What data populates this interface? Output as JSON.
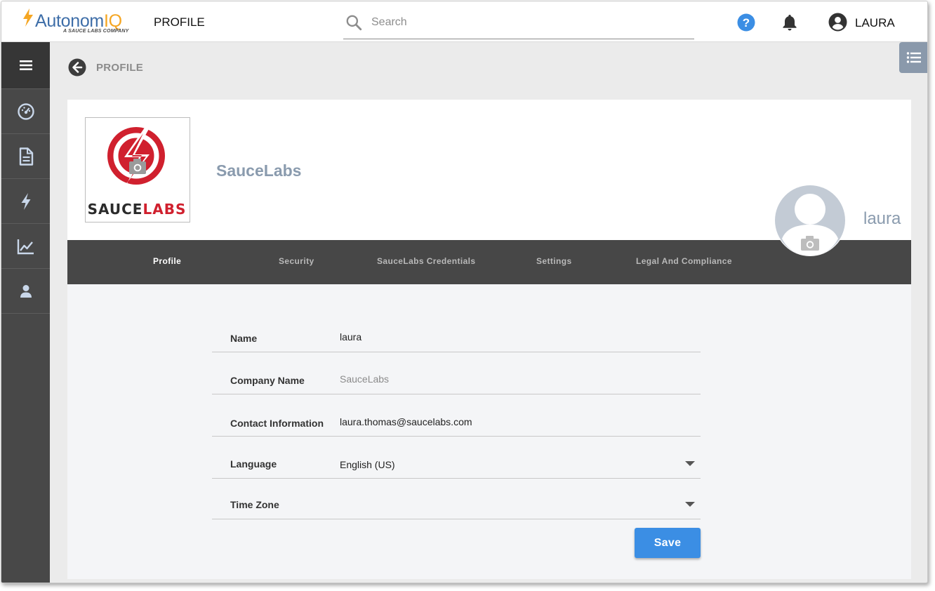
{
  "header": {
    "logo_text_main": "Autonom",
    "logo_text_accent": "IQ",
    "logo_subtitle": "A SAUCE LABS COMPANY",
    "page_title": "PROFILE",
    "search_placeholder": "Search",
    "user_name": "LAURA"
  },
  "sidebar": {
    "items": [
      {
        "icon": "menu-icon"
      },
      {
        "icon": "dashboard-icon"
      },
      {
        "icon": "document-icon"
      },
      {
        "icon": "lightning-icon"
      },
      {
        "icon": "chart-line-icon"
      },
      {
        "icon": "person-icon"
      }
    ]
  },
  "breadcrumb": {
    "label": "PROFILE"
  },
  "profile": {
    "company_logo_text": "SAUCELABS",
    "company_logo_text_part1": "SAUCE",
    "company_logo_text_part2": "LABS",
    "company_name": "SauceLabs",
    "user_display_name": "laura"
  },
  "tabs": [
    {
      "label": "Profile",
      "active": true
    },
    {
      "label": "Security",
      "active": false
    },
    {
      "label": "SauceLabs Credentials",
      "active": false
    },
    {
      "label": "Settings",
      "active": false
    },
    {
      "label": "Legal And Compliance",
      "active": false
    }
  ],
  "form": {
    "name": {
      "label": "Name",
      "value": "laura"
    },
    "company": {
      "label": "Company Name",
      "value": "SauceLabs"
    },
    "contact": {
      "label": "Contact Information",
      "value": "laura.thomas@saucelabs.com"
    },
    "language": {
      "label": "Language",
      "value": "English (US)"
    },
    "timezone": {
      "label": "Time Zone",
      "value": ""
    },
    "save_label": "Save"
  },
  "colors": {
    "accent": "#3b8ee4",
    "sidebar": "#484848",
    "tab_bar": "#474747",
    "brand_red": "#d0202e",
    "logo_blue": "#3e6ea8",
    "logo_orange": "#f5a623"
  }
}
